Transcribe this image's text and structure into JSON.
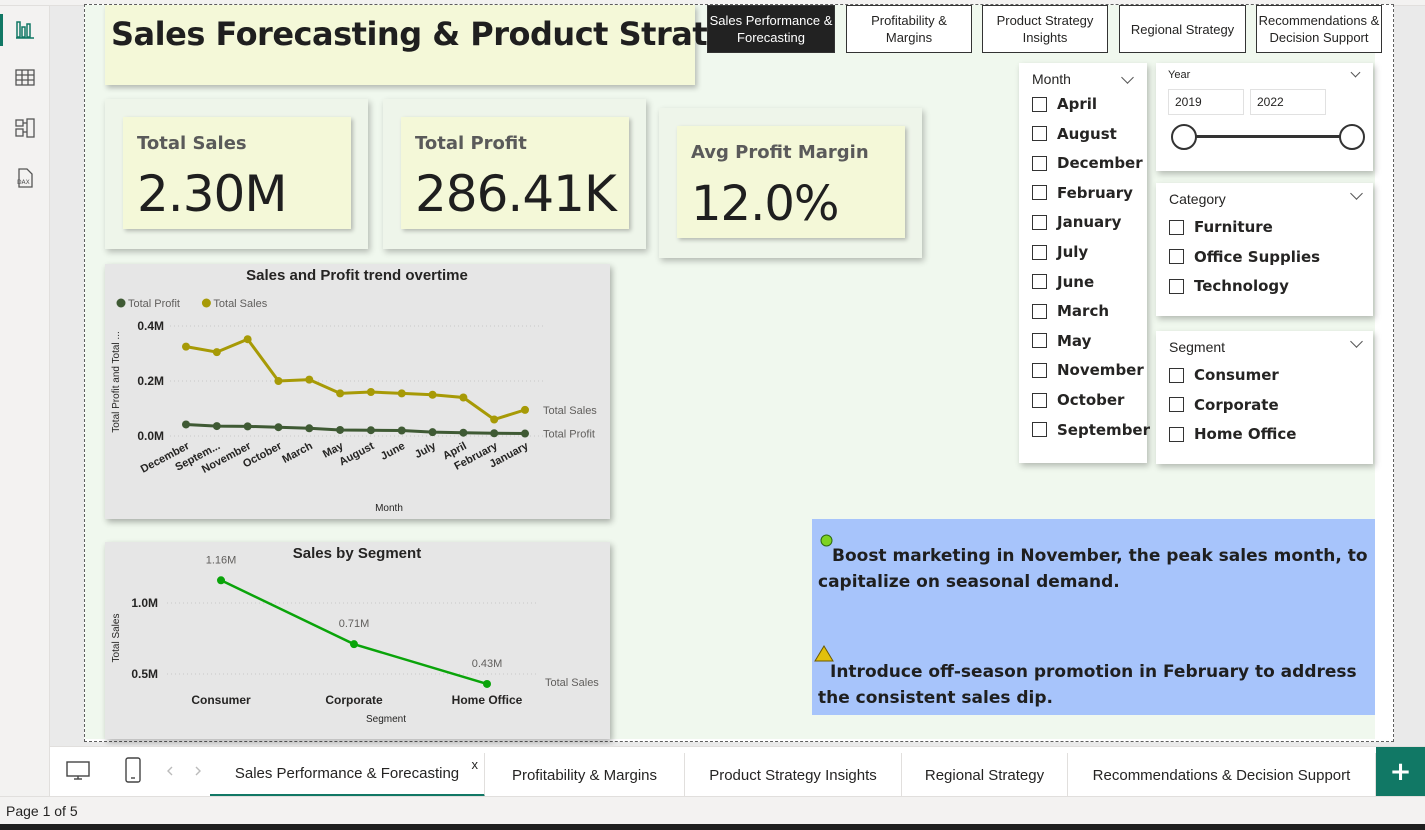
{
  "report": {
    "title": "Sales Forecasting & Product Strategy"
  },
  "nav_buttons": [
    {
      "label": "Sales Performance & Forecasting",
      "active": true
    },
    {
      "label": "Profitability & Margins"
    },
    {
      "label": "Product Strategy Insights"
    },
    {
      "label": "Regional Strategy"
    },
    {
      "label": "Recommendations & Decision Support"
    }
  ],
  "kpis": {
    "total_sales": {
      "label": "Total Sales",
      "value": "2.30M"
    },
    "total_profit": {
      "label": "Total Profit",
      "value": "286.41K"
    },
    "avg_margin": {
      "label": "Avg Profit Margin",
      "value": "12.0%"
    }
  },
  "slicers": {
    "month": {
      "title": "Month",
      "items": [
        "April",
        "August",
        "December",
        "February",
        "January",
        "July",
        "June",
        "March",
        "May",
        "November",
        "October",
        "September"
      ]
    },
    "year": {
      "title": "Year",
      "from": "2019",
      "to": "2022"
    },
    "category": {
      "title": "Category",
      "items": [
        "Furniture",
        "Office Supplies",
        "Technology"
      ]
    },
    "segment": {
      "title": "Segment",
      "items": [
        "Consumer",
        "Corporate",
        "Home Office"
      ]
    }
  },
  "recommendations": [
    {
      "icon": "green-circle-icon",
      "text": "Boost marketing in November, the peak sales month, to capitalize on seasonal demand."
    },
    {
      "icon": "warning-triangle-icon",
      "text": "Introduce off-season promotion in February to address the consistent sales dip."
    }
  ],
  "chart_data": [
    {
      "type": "line",
      "title": "Sales and Profit trend overtime",
      "xlabel": "Month",
      "ylabel": "Total Profit and Total ...",
      "categories": [
        "December",
        "Septem...",
        "November",
        "October",
        "March",
        "May",
        "August",
        "June",
        "July",
        "April",
        "February",
        "January"
      ],
      "series": [
        {
          "name": "Total Sales",
          "color": "#a79a06",
          "values": [
            0.325,
            0.305,
            0.352,
            0.2,
            0.205,
            0.155,
            0.16,
            0.155,
            0.15,
            0.14,
            0.06,
            0.095
          ]
        },
        {
          "name": "Total Profit",
          "color": "#3f5a34",
          "values": [
            0.042,
            0.036,
            0.035,
            0.032,
            0.028,
            0.022,
            0.021,
            0.02,
            0.014,
            0.012,
            0.01,
            0.009
          ]
        }
      ],
      "yticks": [
        "0.0M",
        "0.2M",
        "0.4M"
      ],
      "ylim": [
        0,
        0.4
      ],
      "legend": [
        "Total Profit",
        "Total Sales"
      ],
      "legend_position": "top-left",
      "grid": true
    },
    {
      "type": "line",
      "title": "Sales by Segment",
      "xlabel": "Segment",
      "ylabel": "Total Sales",
      "categories": [
        "Consumer",
        "Corporate",
        "Home Office"
      ],
      "series": [
        {
          "name": "Total Sales",
          "color": "#0aa40a",
          "values": [
            1.16,
            0.71,
            0.43
          ],
          "labels": [
            "1.16M",
            "0.71M",
            "0.43M"
          ]
        }
      ],
      "yticks": [
        "0.5M",
        "1.0M"
      ],
      "ylim": [
        0.4,
        1.2
      ],
      "grid": true
    }
  ],
  "tabs": [
    {
      "label": "Sales Performance & Forecasting",
      "active": true,
      "close": "x"
    },
    {
      "label": "Profitability & Margins"
    },
    {
      "label": "Product Strategy Insights"
    },
    {
      "label": "Regional Strategy"
    },
    {
      "label": "Recommendations & Decision Support"
    }
  ],
  "add_tab_label": "+",
  "status": {
    "page": "Page 1 of 5"
  }
}
